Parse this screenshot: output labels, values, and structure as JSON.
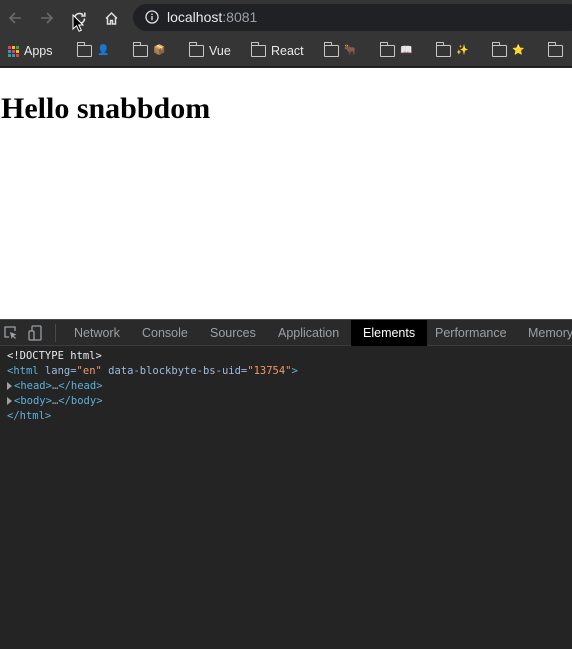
{
  "browser": {
    "url_host": "localhost",
    "url_port": ":8081",
    "icons": {
      "back": "arrow-left-icon",
      "forward": "arrow-right-icon",
      "reload": "reload-icon",
      "home": "home-icon",
      "site_info": "info-circle-icon"
    }
  },
  "bookmarks": {
    "apps_label": "Apps",
    "items": [
      {
        "label": "",
        "emoji": "👤"
      },
      {
        "label": "",
        "emoji": "📦"
      },
      {
        "label": "Vue",
        "emoji": ""
      },
      {
        "label": "React",
        "emoji": ""
      },
      {
        "label": "",
        "emoji": "🐂"
      },
      {
        "label": "",
        "emoji": "📖"
      },
      {
        "label": "",
        "emoji": "✨"
      },
      {
        "label": "",
        "emoji": "⭐"
      },
      {
        "label": "",
        "emoji": ""
      }
    ]
  },
  "page": {
    "heading": "Hello snabbdom"
  },
  "devtools": {
    "tabs": [
      "Network",
      "Console",
      "Sources",
      "Application",
      "Elements",
      "Performance",
      "Memory"
    ],
    "active_tab": "Elements",
    "dom": {
      "doctype": "<!DOCTYPE html>",
      "html_open_tag": "<html",
      "attr_lang_name": " lang=",
      "attr_lang_value": "\"en\"",
      "attr_uid_name": " data-blockbyte-bs-uid=",
      "attr_uid_value": "\"13754\"",
      "html_open_close": ">",
      "head_collapsed_open": "<head>",
      "head_ellipsis": "…",
      "head_close": "</head>",
      "body_collapsed_open": "<body>",
      "body_ellipsis": "…",
      "body_close": "</body>",
      "html_close": "</html>"
    }
  },
  "colors": {
    "toolbar_bg": "#353535",
    "devtools_bg": "#242424",
    "active_tab_bg": "#000000",
    "tag_color": "#5db0d7",
    "attr_value_color": "#f29766"
  }
}
